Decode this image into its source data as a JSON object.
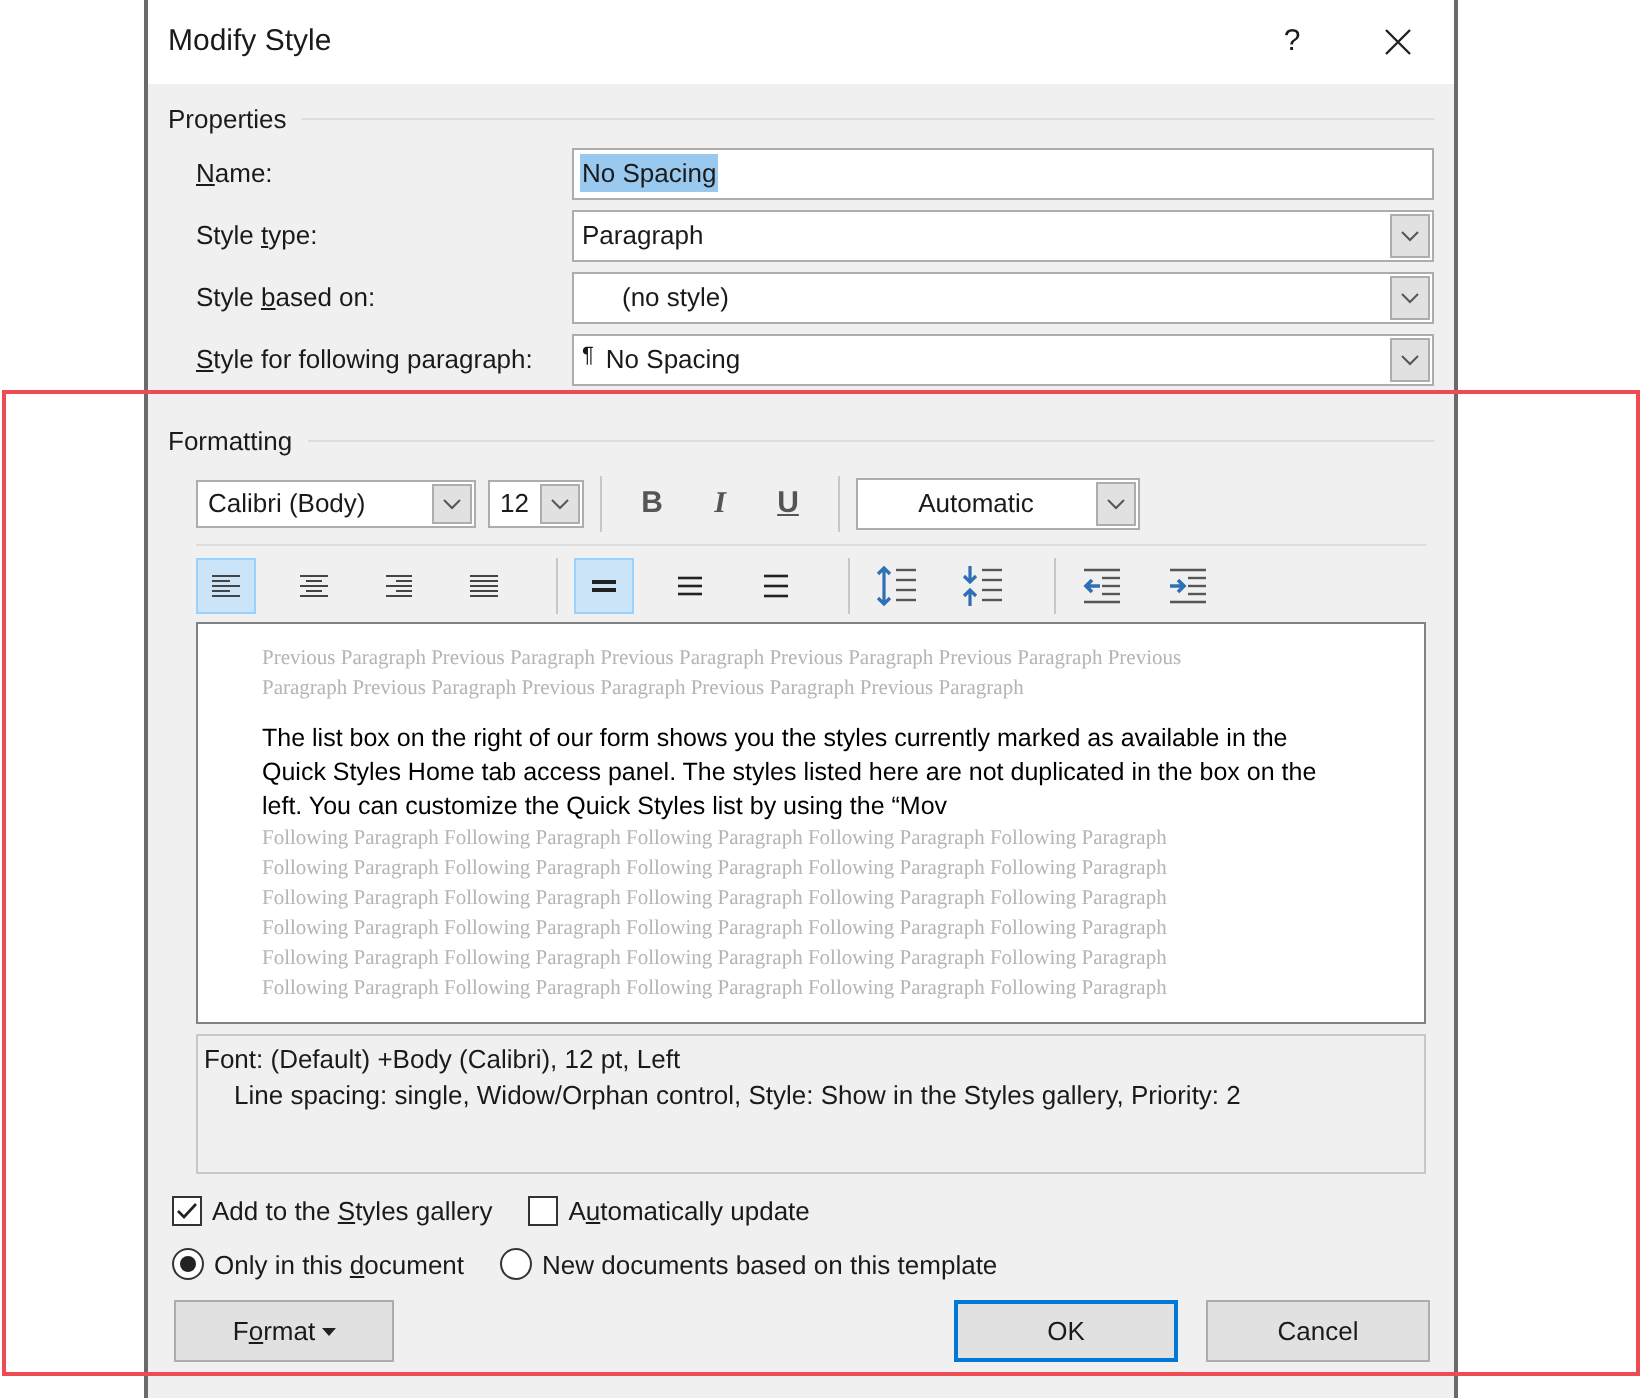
{
  "window": {
    "title": "Modify Style",
    "help": "?"
  },
  "properties": {
    "title": "Properties",
    "name": {
      "label": {
        "key": "N",
        "post": "ame:"
      },
      "value": "No Spacing"
    },
    "style_type": {
      "label": {
        "pre": "Style ",
        "key": "t",
        "post": "ype:"
      },
      "value": "Paragraph"
    },
    "based_on": {
      "label": {
        "pre": "Style ",
        "key": "b",
        "post": "ased on:"
      },
      "value": "(no style)"
    },
    "following": {
      "label": {
        "key": "S",
        "post": "tyle for following paragraph:"
      },
      "mark": "¶",
      "value": "No Spacing"
    }
  },
  "formatting": {
    "title": "Formatting",
    "font": "Calibri (Body)",
    "size": "12",
    "styles": [
      {
        "kind": "bold",
        "label": "B"
      },
      {
        "kind": "italic",
        "label": "I"
      },
      {
        "kind": "underline",
        "label": "U"
      }
    ],
    "font_color": "Automatic",
    "alignment": [
      {
        "kind": "left",
        "selected": true
      },
      {
        "kind": "center",
        "selected": false
      },
      {
        "kind": "right",
        "selected": false
      },
      {
        "kind": "justify",
        "selected": false
      }
    ],
    "spacing": [
      {
        "kind": "single",
        "selected": true
      },
      {
        "kind": "onehalf",
        "selected": false
      },
      {
        "kind": "double",
        "selected": false
      }
    ],
    "paragraph_spacing": [
      {
        "kind": "increase"
      },
      {
        "kind": "decrease"
      }
    ],
    "indent": [
      {
        "kind": "decrease"
      },
      {
        "kind": "increase"
      }
    ]
  },
  "preview": {
    "previous": [
      "Previous Paragraph Previous Paragraph Previous Paragraph Previous Paragraph Previous Paragraph Previous",
      "Paragraph Previous Paragraph Previous Paragraph Previous Paragraph Previous Paragraph"
    ],
    "sample": [
      "The list box on the right of our form shows you the styles currently marked as available in the",
      "Quick Styles Home tab access panel. The styles listed here are not duplicated in the box on the",
      "left. You can customize the Quick Styles list by using the “Mov"
    ],
    "following": [
      "Following Paragraph Following Paragraph Following Paragraph Following Paragraph Following Paragraph",
      "Following Paragraph Following Paragraph Following Paragraph Following Paragraph Following Paragraph",
      "Following Paragraph Following Paragraph Following Paragraph Following Paragraph Following Paragraph",
      "Following Paragraph Following Paragraph Following Paragraph Following Paragraph Following Paragraph",
      "Following Paragraph Following Paragraph Following Paragraph Following Paragraph Following Paragraph",
      "Following Paragraph Following Paragraph Following Paragraph Following Paragraph Following Paragraph"
    ]
  },
  "description": [
    "Font: (Default) +Body (Calibri), 12 pt, Left",
    "Line spacing:  single, Widow/Orphan control, Style: Show in the Styles gallery, Priority: 2"
  ],
  "options": [
    {
      "label": {
        "pre": "Add to the ",
        "key": "S",
        "post": "tyles gallery"
      },
      "checked": true
    },
    {
      "label": {
        "pre": "A",
        "key": "u",
        "post": "tomatically update"
      },
      "checked": false
    }
  ],
  "scope": [
    {
      "label": {
        "pre": "Only in this ",
        "key": "d",
        "post": "ocument"
      },
      "selected": true
    },
    {
      "label": {
        "pre": "New documents based on this template"
      },
      "selected": false
    }
  ],
  "buttons": {
    "format": {
      "pre": "F",
      "key": "o",
      "post": "rmat"
    },
    "ok": "OK",
    "cancel": "Cancel"
  },
  "annotation": {
    "kind": "highlight",
    "color": "#ef4b52"
  }
}
